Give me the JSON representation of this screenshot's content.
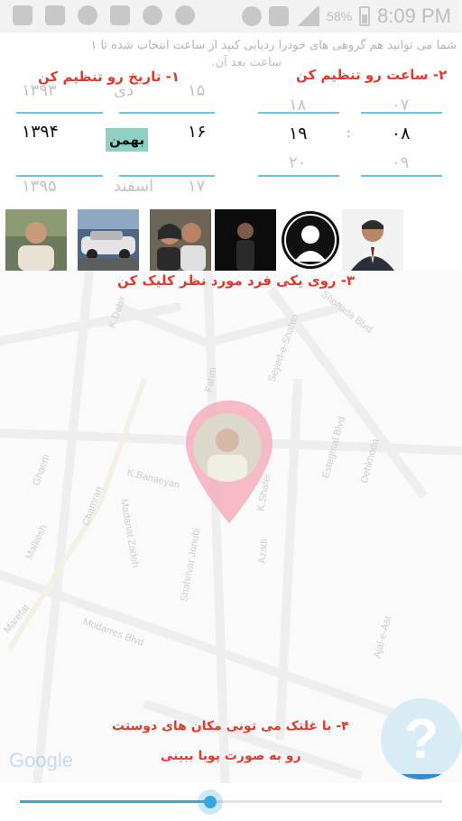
{
  "status_bar": {
    "icons_left": [
      "add-icon",
      "usb-icon",
      "telegram-icon",
      "document-icon",
      "location-icon",
      "search-icon"
    ],
    "icons_right": [
      "eye-icon",
      "wifi-icon",
      "signal-icon"
    ],
    "battery_percent": "58%",
    "time": "8:09 PM"
  },
  "intro": {
    "text": "شما می توانید هم گروهی های خودرا ردیابی کنید از ساعت انتخاب شده تا ۱",
    "text2": "ساعت بعد آن."
  },
  "steps": {
    "step1": "۱- تاریخ رو تنظیم کن",
    "step2": "۲- ساعت رو تنظیم کن",
    "step3": "۳- روی یکی فرد مورد نظر کلیک کن",
    "step4_line1": "۴- با غلتک می تونی مکان های دوستت",
    "step4_line2": "رو به صورت پویا ببینی"
  },
  "date_picker": {
    "day": {
      "prev": "۱۵",
      "selected": "۱۶",
      "next": "۱۷"
    },
    "month": {
      "prev": "دی",
      "selected": "بهمن",
      "next": "اسفند"
    },
    "year": {
      "prev": "۱۳۹۳",
      "selected": "۱۳۹۴",
      "next": "۱۳۹۵"
    }
  },
  "time_picker": {
    "hour": {
      "prev": "۱۸",
      "selected": "۱۹",
      "next": "۲۰"
    },
    "separator": ":",
    "minute": {
      "prev": "۰۷",
      "selected": "۰۸",
      "next": "۰۹"
    }
  },
  "contacts": [
    "contact-1",
    "car-contact",
    "couple-contact",
    "contact-dark",
    "empty-avatar",
    "contact-suit"
  ],
  "map": {
    "labels": [
      "K.Dabir",
      "Shohada Blvd",
      "Fahm",
      "Seyed-e-Shahin",
      "K.Banaeyan",
      "Chamran",
      "Ghaem",
      "Malkesh",
      "Madanat Zadeh",
      "Shahrivar Jonubi",
      "Azadi",
      "K.Shafei",
      "Estegmal Blvd",
      "Dehkhoda",
      "Modarres Blvd",
      "Marefat",
      "Ajal-e-Asr"
    ],
    "google_logo": "Google"
  },
  "slider": {
    "value_fraction": 0.45
  },
  "colors": {
    "accent_red": "#e03a2f",
    "accent_blue": "#39a6df",
    "month_highlight": "#8dd0c4"
  }
}
